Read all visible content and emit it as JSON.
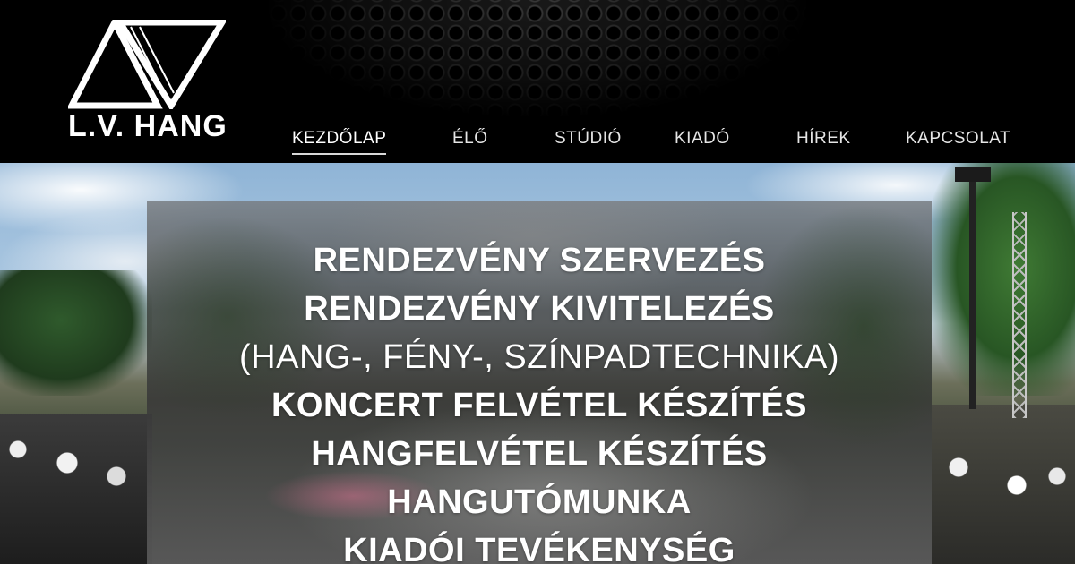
{
  "brand": {
    "logo_text": "L.V. HANG"
  },
  "nav": {
    "items": [
      {
        "label": "KEZDŐLAP",
        "active": true
      },
      {
        "label": "ÉLŐ",
        "active": false
      },
      {
        "label": "STÚDIÓ",
        "active": false
      },
      {
        "label": "KIADÓ",
        "active": false
      },
      {
        "label": "HÍREK",
        "active": false
      },
      {
        "label": "KAPCSOLAT",
        "active": false
      }
    ]
  },
  "hero": {
    "services": [
      {
        "text": "RENDEZVÉNY SZERVEZÉS",
        "weight": "bold"
      },
      {
        "text": "RENDEZVÉNY KIVITELEZÉS",
        "weight": "bold"
      },
      {
        "text": "(HANG-, FÉNY-, SZÍNPADTECHNIKA)",
        "weight": "light"
      },
      {
        "text": "KONCERT FELVÉTEL KÉSZÍTÉS",
        "weight": "bold"
      },
      {
        "text": "HANGFELVÉTEL KÉSZÍTÉS",
        "weight": "bold"
      },
      {
        "text": "HANGUTÓMUNKA",
        "weight": "bold"
      },
      {
        "text": "KIADÓI TEVÉKENYSÉG",
        "weight": "bold"
      }
    ]
  },
  "colors": {
    "header_bg": "#000000",
    "nav_text": "#e6e6e6",
    "hero_text": "#ffffff"
  }
}
